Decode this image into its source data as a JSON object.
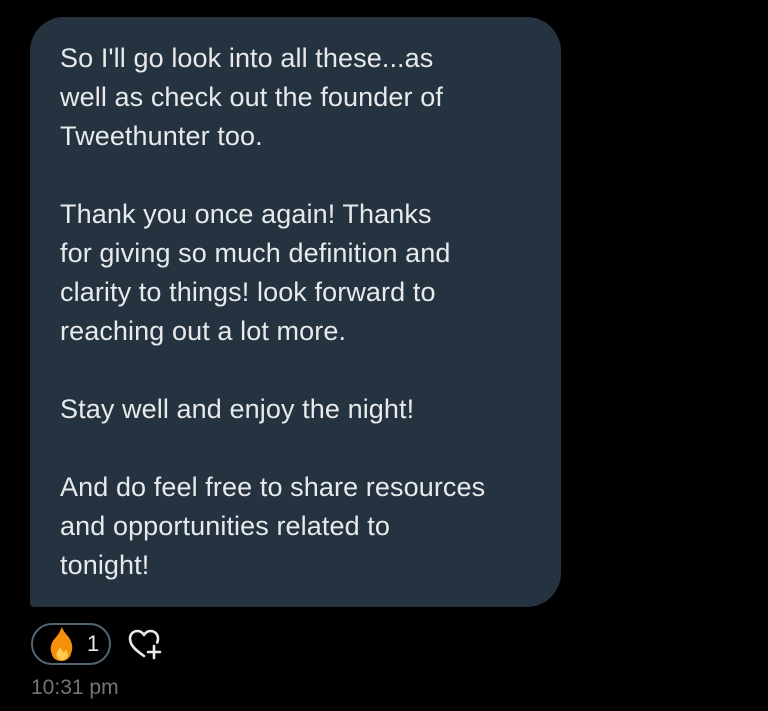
{
  "message": {
    "paragraphs": [
      [
        "So I'll go look into all these...as",
        "well as check out the founder of",
        "Tweethunter too."
      ],
      [
        "Thank you once again! Thanks",
        "for giving so much definition and",
        "clarity to things! look forward to",
        "reaching out a lot more."
      ],
      [
        "Stay well and enjoy the night!"
      ],
      [
        "And do feel free to share resources",
        "and opportunities related to",
        "tonight!"
      ]
    ],
    "bubble_color": "#253341",
    "text_color": "#e7e9ea"
  },
  "reactions": {
    "emoji_icon": "fire-emoji-icon",
    "count": "1",
    "add_icon": "heart-plus-icon"
  },
  "timestamp": "10:31 pm"
}
